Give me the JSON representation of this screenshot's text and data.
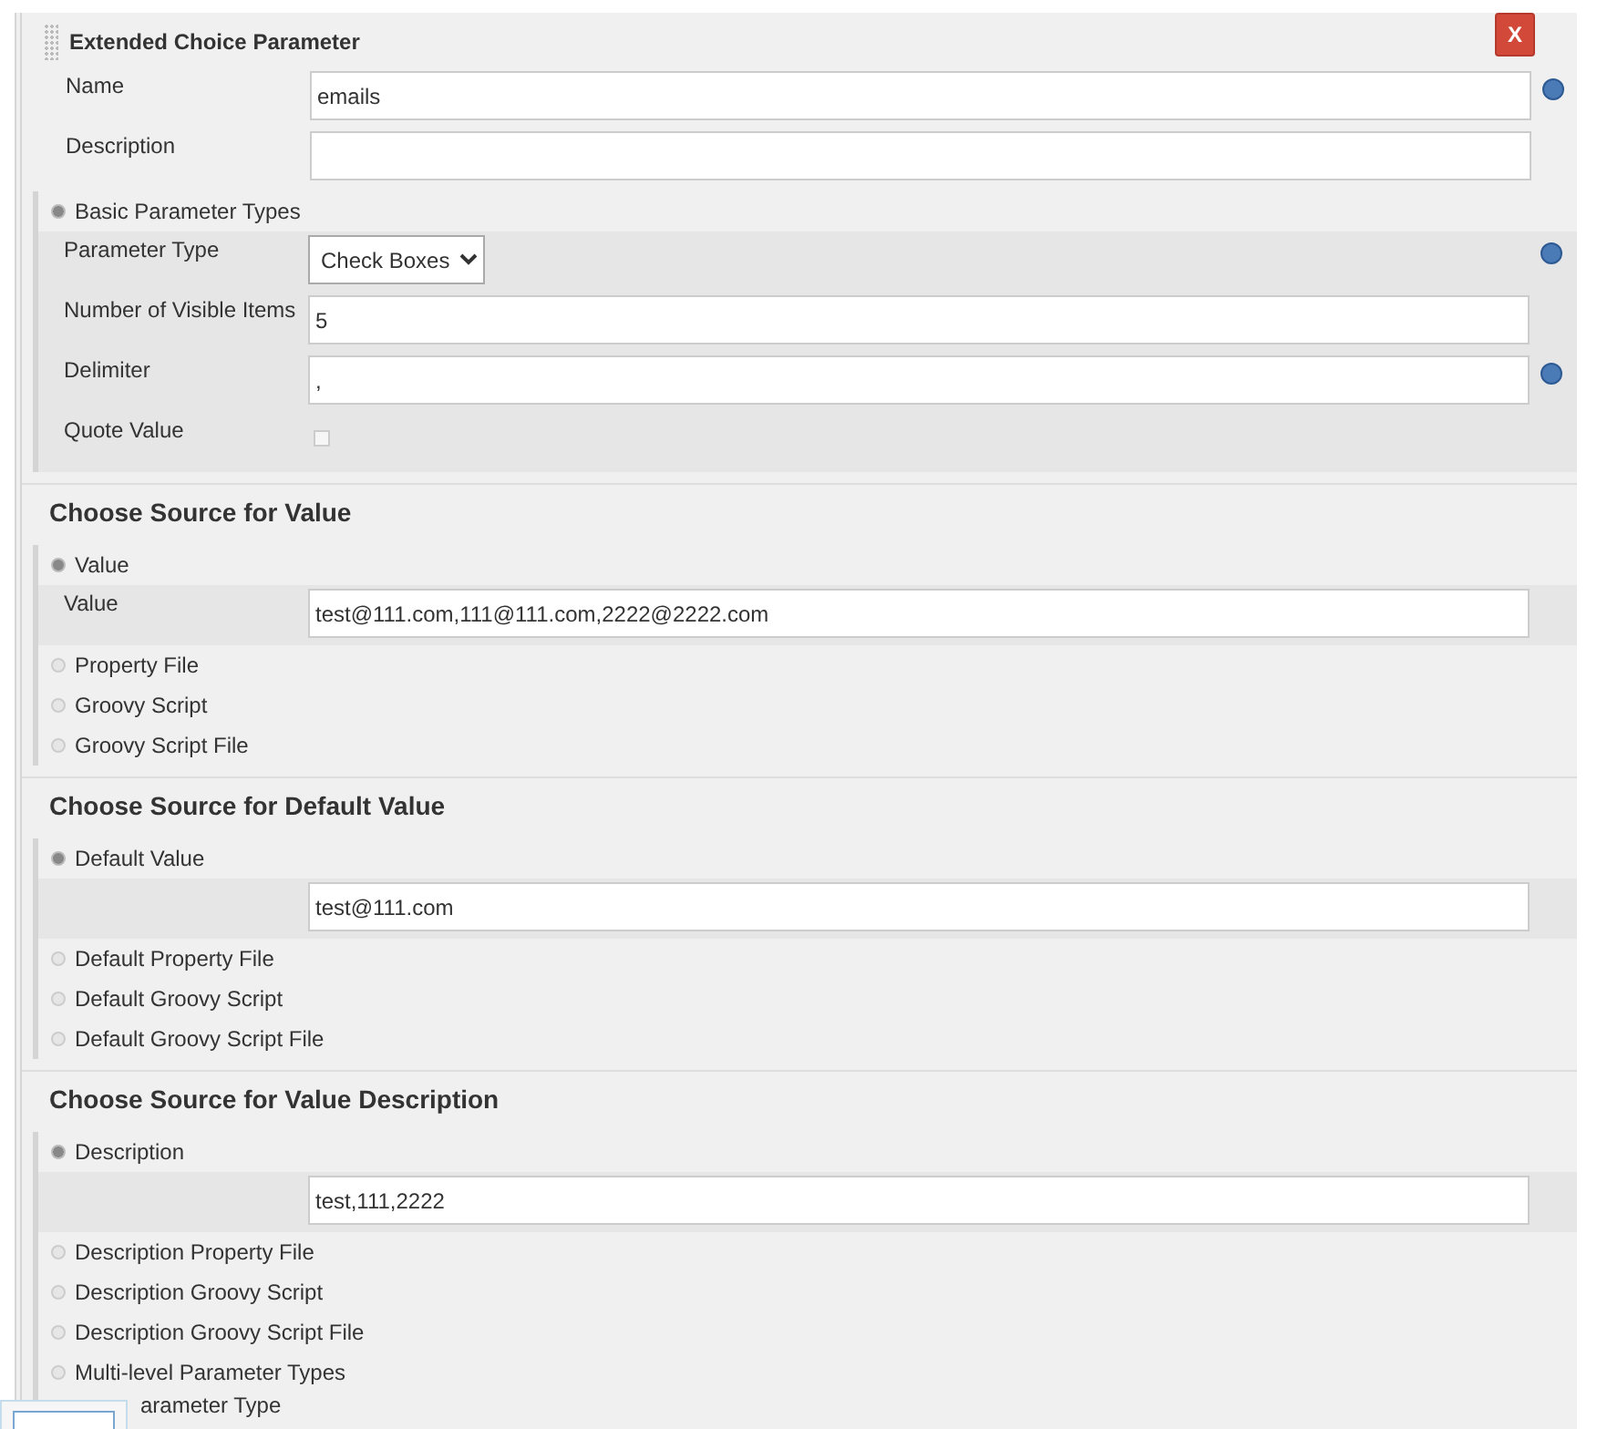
{
  "panel": {
    "title": "Extended Choice Parameter",
    "delete_label": "X",
    "fields": [
      {
        "label": "Name",
        "value": "emails",
        "help": true
      },
      {
        "label": "Description",
        "help": false
      }
    ]
  },
  "parameter_types": [
    {
      "label": "Basic Parameter Types",
      "selected": true,
      "rows": [
        {
          "kind": "select",
          "label": "Parameter Type",
          "value": "Check Boxes",
          "help": true
        },
        {
          "kind": "text",
          "label": "Number of Visible Items",
          "value": "5",
          "help": false
        },
        {
          "kind": "text",
          "label": "Delimiter",
          "value": ",",
          "help": true
        },
        {
          "kind": "checkbox",
          "label": "Quote Value",
          "checked": false,
          "help": false
        }
      ]
    }
  ],
  "sections": [
    {
      "heading": "Choose Source for Value",
      "options": [
        {
          "label": "Value",
          "selected": true,
          "rows": [
            {
              "label": "Value",
              "value": "test@111.com,111@111.com,2222@2222.com"
            }
          ]
        },
        {
          "label": "Property File",
          "selected": false
        },
        {
          "label": "Groovy Script",
          "selected": false
        },
        {
          "label": "Groovy Script File",
          "selected": false
        }
      ]
    },
    {
      "heading": "Choose Source for Default Value",
      "options": [
        {
          "label": "Default Value",
          "selected": true,
          "rows": [
            {
              "value": "test@111.com"
            }
          ]
        },
        {
          "label": "Default Property File",
          "selected": false
        },
        {
          "label": "Default Groovy Script",
          "selected": false
        },
        {
          "label": "Default Groovy Script File",
          "selected": false
        }
      ]
    },
    {
      "heading": "Choose Source for Value Description",
      "options": [
        {
          "label": "Description",
          "selected": true,
          "rows": [
            {
              "value": "test,111,2222"
            }
          ]
        },
        {
          "label": "Description Property File",
          "selected": false
        },
        {
          "label": "Description Groovy Script",
          "selected": false
        },
        {
          "label": "Description Groovy Script File",
          "selected": false
        }
      ]
    }
  ],
  "more_types": [
    {
      "label": "Multi-level Parameter Types",
      "selected": false
    }
  ],
  "cut_row": {
    "label": "arameter Type"
  }
}
